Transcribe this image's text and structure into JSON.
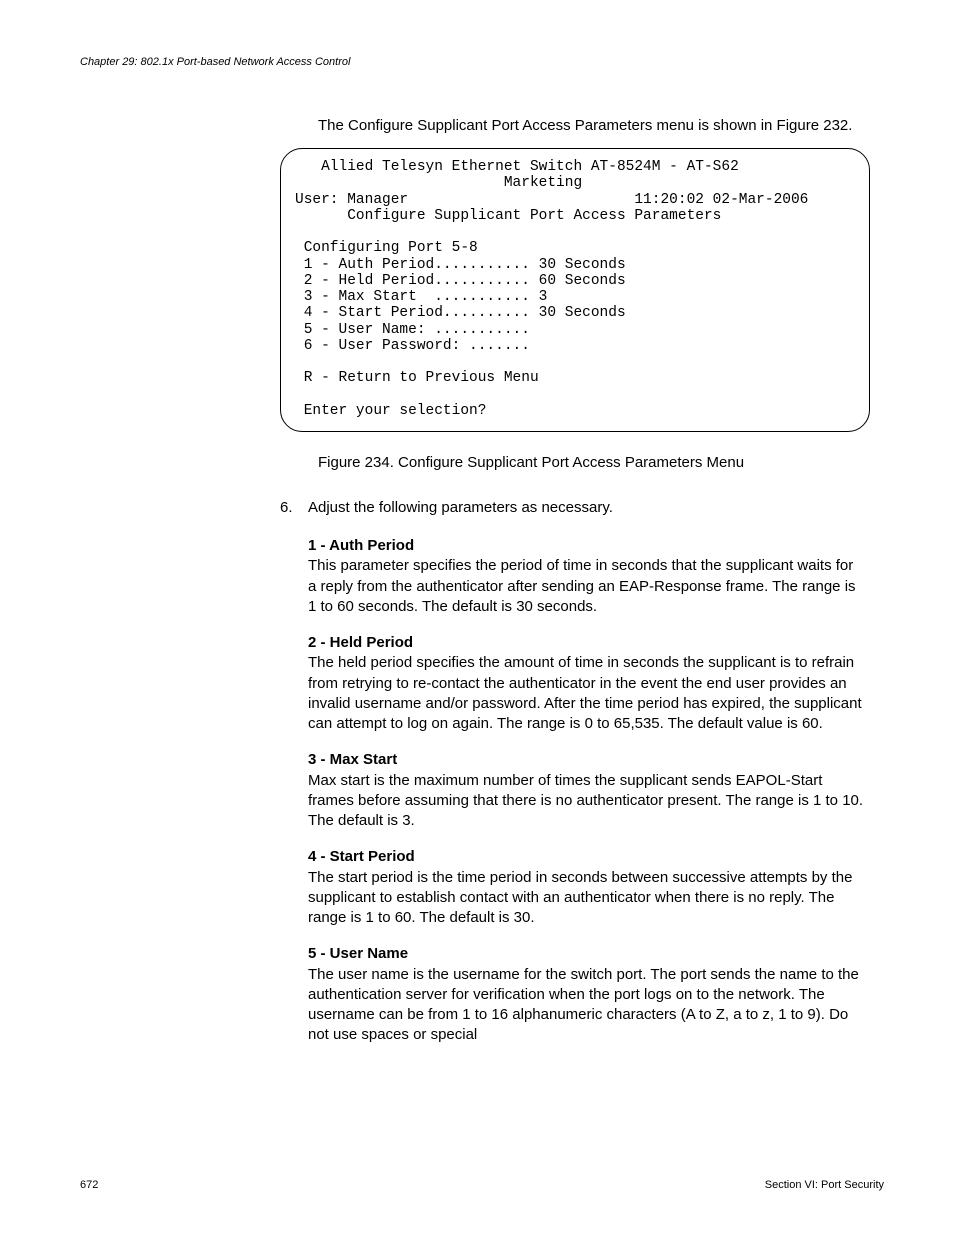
{
  "header": {
    "chapter": "Chapter 29: 802.1x Port-based Network Access Control"
  },
  "intro": "The Configure Supplicant Port Access Parameters menu is shown in Figure 232.",
  "terminal": {
    "title_line": "   Allied Telesyn Ethernet Switch AT-8524M - AT-S62",
    "subtitle_line": "                        Marketing",
    "user_line": "User: Manager                          11:20:02 02-Mar-2006",
    "menu_title": "      Configure Supplicant Port Access Parameters",
    "config_line": " Configuring Port 5-8",
    "item1": " 1 - Auth Period........... 30 Seconds",
    "item2": " 2 - Held Period........... 60 Seconds",
    "item3": " 3 - Max Start  ........... 3",
    "item4": " 4 - Start Period.......... 30 Seconds",
    "item5": " 5 - User Name: ...........",
    "item6": " 6 - User Password: .......",
    "return_line": " R - Return to Previous Menu",
    "prompt": " Enter your selection?"
  },
  "caption": "Figure 234. Configure Supplicant Port Access Parameters Menu",
  "step": {
    "num": "6.",
    "text": "Adjust the following parameters as necessary."
  },
  "params": [
    {
      "title": "1 - Auth Period",
      "body": "This parameter specifies the period of time in seconds that the supplicant waits for a reply from the authenticator after sending an EAP-Response frame. The range is 1 to 60 seconds. The default is 30 seconds."
    },
    {
      "title": "2 - Held Period",
      "body": "The held period specifies the amount of time in seconds the supplicant is to refrain from retrying to re-contact the authenticator in the event the end user provides an invalid username and/or password. After the time period has expired, the supplicant can attempt to log on again. The range is 0 to 65,535. The default value is 60."
    },
    {
      "title": "3 - Max Start",
      "body": "Max start is the maximum number of times the supplicant sends EAPOL-Start frames before assuming that there is no authenticator present. The range is 1 to 10. The default is 3."
    },
    {
      "title": "4 - Start Period",
      "body": "The start period is the time period in seconds between successive attempts by the supplicant to establish contact with an authenticator when there is no reply. The range is 1 to 60. The default is 30."
    },
    {
      "title": "5 - User Name",
      "body": "The user name is the username for the switch port. The port sends the name to the authentication server for verification when the port logs on to the network. The username can be from 1 to 16 alphanumeric characters (A to Z, a to z, 1 to 9). Do not use spaces or special"
    }
  ],
  "footer": {
    "page": "672",
    "section": "Section VI: Port Security"
  }
}
